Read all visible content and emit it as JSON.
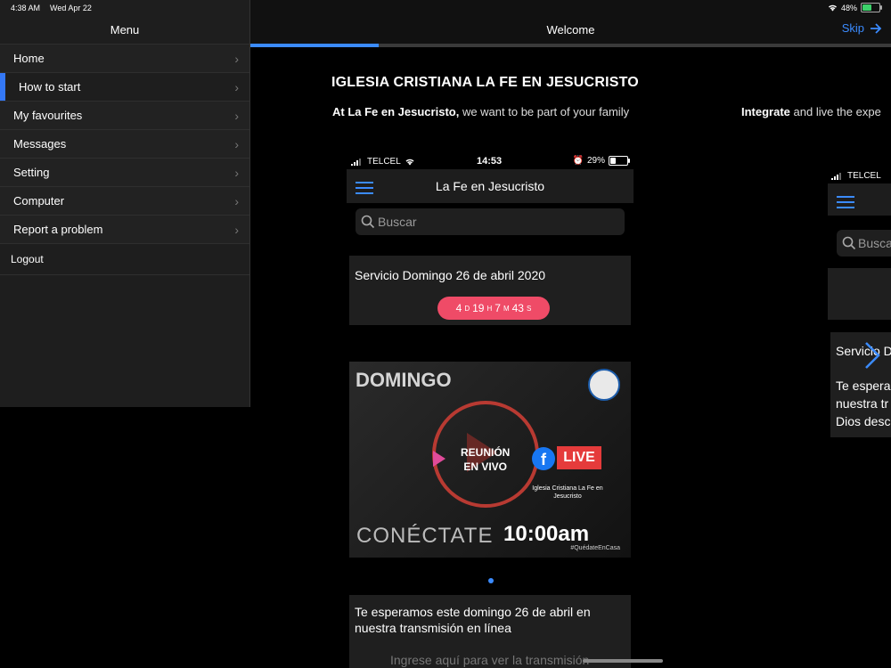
{
  "statusbar": {
    "time": "4:38 AM",
    "date": "Wed Apr 22",
    "battery": "48%"
  },
  "sidebar": {
    "title": "Menu",
    "items": [
      {
        "label": "Home"
      },
      {
        "label": "How to start"
      },
      {
        "label": "My favourites"
      },
      {
        "label": "Messages"
      },
      {
        "label": "Setting"
      },
      {
        "label": "Computer"
      },
      {
        "label": "Report a problem"
      }
    ],
    "logout": "Logout"
  },
  "header": {
    "title": "Welcome",
    "skip": "Skip"
  },
  "intro": {
    "heading": "IGLESIA CRISTIANA LA FE EN JESUCRISTO",
    "sub_bold": "At La Fe en Jesucristo,",
    "sub_rest": " we want to be part of your family",
    "sub2_bold": "Integrate",
    "sub2_rest": " and live the expe"
  },
  "phone": {
    "carrier": "TELCEL",
    "time": "14:53",
    "battery": "29%",
    "app_title": "La Fe en Jesucristo",
    "search_placeholder": "Buscar",
    "service_title": "Servicio Domingo 26 de abril 2020",
    "countdown": {
      "d": "4",
      "d_label": "D",
      "h": "19",
      "h_label": "H",
      "m": "7",
      "m_label": "M",
      "s": "43",
      "s_label": "S"
    },
    "banner": {
      "domingo": "DOMINGO",
      "reunion1": "REUNIÓN",
      "reunion2": "EN VIVO",
      "fb": "f",
      "live": "LIVE",
      "church": "Iglesia Cristiana La Fe en Jesucristo",
      "conectate": "CONÉCTATE",
      "time": "10:00am",
      "tag": "#QuédateEnCasa"
    },
    "message": "Te esperamos este domingo 26 de abril en nuestra transmisión en línea",
    "link": "Ingrese aquí para ver la transmisión"
  },
  "phone2": {
    "carrier": "TELCEL",
    "search_placeholder": "Busca",
    "card_title": "Servicio D",
    "card_text1": "Te espera",
    "card_text2": "nuestra tr",
    "card_text3": "Dios desc"
  },
  "progress": {
    "fraction": 0.2
  }
}
